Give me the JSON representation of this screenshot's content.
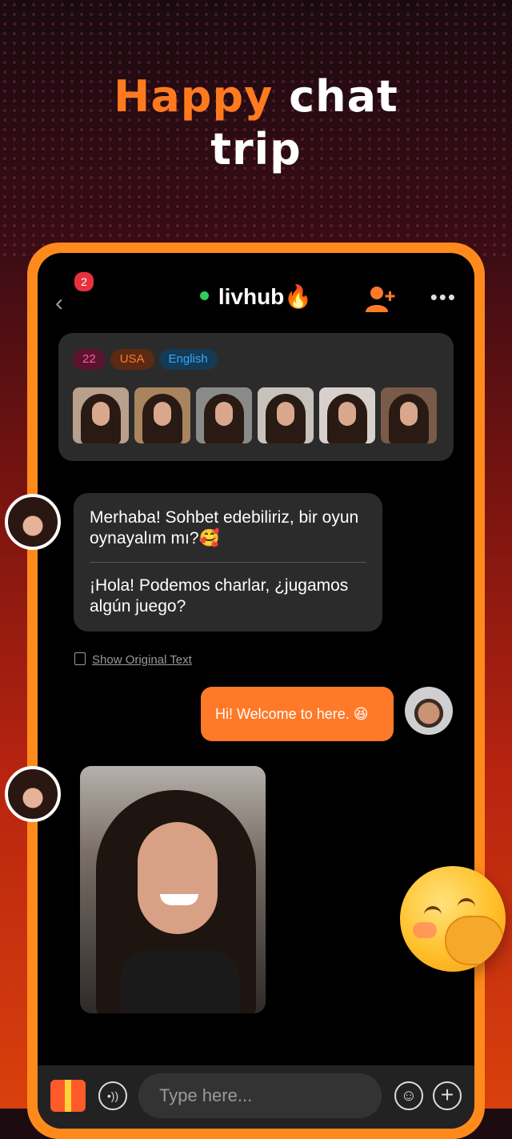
{
  "headline": {
    "accent": "Happy",
    "rest_line1": "chat",
    "line2": "trip"
  },
  "header": {
    "badge_count": "2",
    "username": "livhub",
    "title_emoji": "🔥"
  },
  "profile": {
    "tags": {
      "age": "22",
      "country": "USA",
      "language": "English"
    },
    "photo_count": 6
  },
  "messages": {
    "incoming_original": "Merhaba! Sohbet edebiliriz, bir oyun oynayalım mı?🥰",
    "incoming_translated": "¡Hola! Podemos charlar, ¿jugamos algún juego?",
    "show_original": "Show Original Text",
    "outgoing": "Hi! Welcome to here. 😆"
  },
  "composer": {
    "placeholder": "Type here..."
  },
  "colors": {
    "accent": "#ff7a28",
    "online": "#2ed05a",
    "badge": "#e8313f"
  }
}
